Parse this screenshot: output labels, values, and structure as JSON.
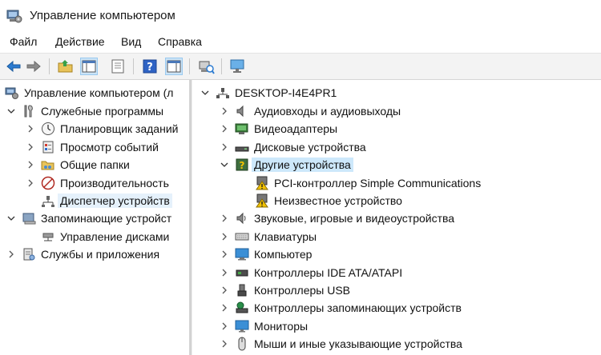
{
  "window": {
    "title": "Управление компьютером"
  },
  "menu": [
    "Файл",
    "Действие",
    "Вид",
    "Справка"
  ],
  "toolbar": {
    "buttons": [
      "back-arrow-icon",
      "forward-arrow-icon",
      "up-folder-icon",
      "show-hide-tree-icon",
      "properties-icon",
      "help-icon",
      "action-pane-icon",
      "scan-hardware-icon",
      "monitor-icon"
    ]
  },
  "left_tree": {
    "root": "Управление компьютером (л",
    "system_tools": "Служебные программы",
    "task_scheduler": "Планировщик заданий",
    "event_viewer": "Просмотр событий",
    "shared_folders": "Общие папки",
    "performance": "Производительность",
    "device_manager": "Диспетчер устройств",
    "storage": "Запоминающие устройст",
    "disk_management": "Управление дисками",
    "services_apps": "Службы и приложения"
  },
  "right_tree": {
    "computer_name": "DESKTOP-I4E4PR1",
    "audio_io": "Аудиовходы и аудиовыходы",
    "video_adapters": "Видеоадаптеры",
    "disk_drives": "Дисковые устройства",
    "other_devices": "Другие устройства",
    "pci_controller": "PCI-контроллер Simple Communications",
    "unknown_device": "Неизвестное устройство",
    "sound_devices": "Звуковые, игровые и видеоустройства",
    "keyboards": "Клавиатуры",
    "computer": "Компьютер",
    "ide_controllers": "Контроллеры IDE ATA/ATAPI",
    "usb_controllers": "Контроллеры USB",
    "storage_controllers": "Контроллеры запоминающих устройств",
    "monitors": "Мониторы",
    "mice": "Мыши и иные указывающие устройства"
  },
  "colors": {
    "selection": "#e5f1fb",
    "highlight": "#cde8fb",
    "warning": "#f2c200"
  }
}
